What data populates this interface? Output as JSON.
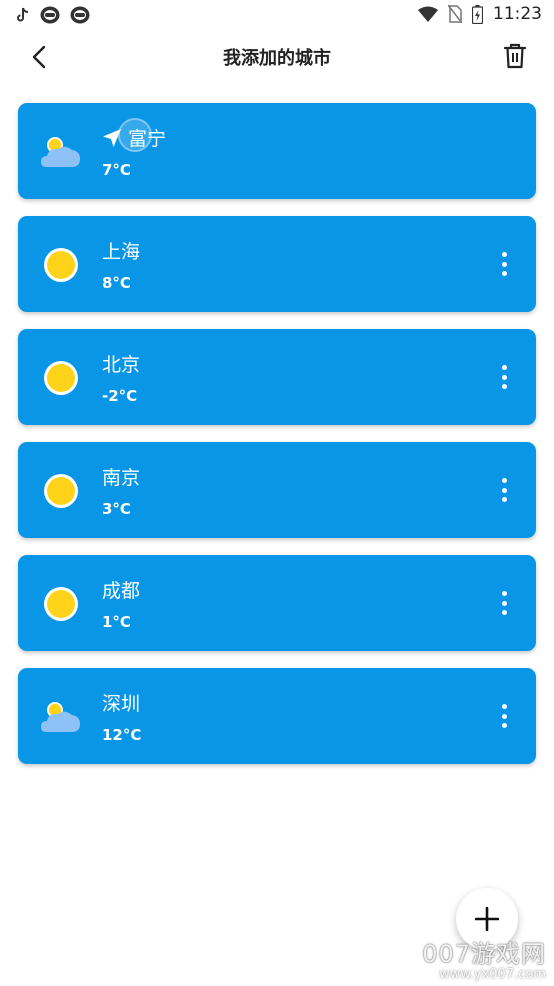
{
  "status_bar": {
    "time": "11:23",
    "left_icons": [
      "tiktok-icon",
      "app-icon",
      "app-icon"
    ],
    "right_icons": [
      "wifi-icon",
      "no-sim-icon",
      "battery-icon"
    ]
  },
  "app_bar": {
    "title": "我添加的城市",
    "back_icon": "chevron-left-icon",
    "delete_icon": "trash-icon"
  },
  "colors": {
    "card": "#0a96e6",
    "sun": "#ffd31a",
    "cloud": "#8ec2f7"
  },
  "cities": [
    {
      "name": "富宁",
      "temp": "7°C",
      "icon": "partly-cloudy-icon",
      "current_location": true
    },
    {
      "name": "上海",
      "temp": "8°C",
      "icon": "sunny-icon",
      "current_location": false
    },
    {
      "name": "北京",
      "temp": "-2°C",
      "icon": "sunny-icon",
      "current_location": false
    },
    {
      "name": "南京",
      "temp": "3°C",
      "icon": "sunny-icon",
      "current_location": false
    },
    {
      "name": "成都",
      "temp": "1°C",
      "icon": "sunny-icon",
      "current_location": false
    },
    {
      "name": "深圳",
      "temp": "12°C",
      "icon": "partly-cloudy-icon",
      "current_location": false
    }
  ],
  "fab": {
    "icon": "plus-icon"
  },
  "watermark": {
    "main": "007游戏网",
    "url": "www.yx007.com"
  }
}
